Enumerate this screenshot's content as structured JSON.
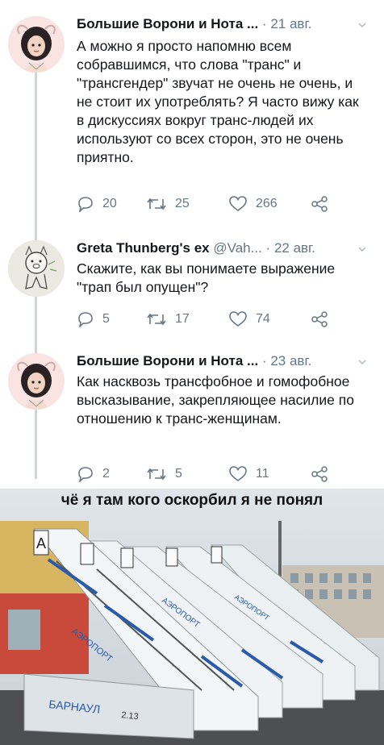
{
  "tweets": [
    {
      "name": "Большие Ворони и Нота ...",
      "handle": "",
      "sep": "·",
      "date": "21 авг.",
      "text": "А можно я просто напомню всем собравшимся, что слова \"транс\" и \"трансгендер\" звучат не очень не очень, и не стоит их употреблять? Я часто вижу как в дискуссиях вокруг транс-людей их используют со всех сторон, это не очень приятно.",
      "replies": "20",
      "retweets": "25",
      "likes": "266"
    },
    {
      "name": "Greta Thunberg's ex",
      "handle": "@Vah...",
      "sep": "·",
      "date": "22 авг.",
      "text": "Скажите, как вы понимаете выражение \"трап был опущен\"?",
      "replies": "5",
      "retweets": "17",
      "likes": "74"
    },
    {
      "name": "Большие Ворони и Нота ...",
      "handle": "",
      "sep": "·",
      "date": "23 авг.",
      "text": "Как насквозь трансфобное и гомофобное высказывание, закрепляющее насилие по отношению к транс-женщинам.",
      "replies": "2",
      "retweets": "5",
      "likes": "11"
    }
  ],
  "meme": {
    "caption": "чё я там кого оскорбил я не понял",
    "ladder_text": "АЭРОПОРТ",
    "ladder_letter": "А",
    "base_text": "БАРНАУЛ",
    "base_number": "2.13"
  },
  "icons": [
    "reply-icon",
    "retweet-icon",
    "like-icon",
    "share-icon",
    "caret-down-icon"
  ],
  "colors": {
    "muted": "#657786",
    "text": "#14171a",
    "line": "#ccd6dd"
  }
}
